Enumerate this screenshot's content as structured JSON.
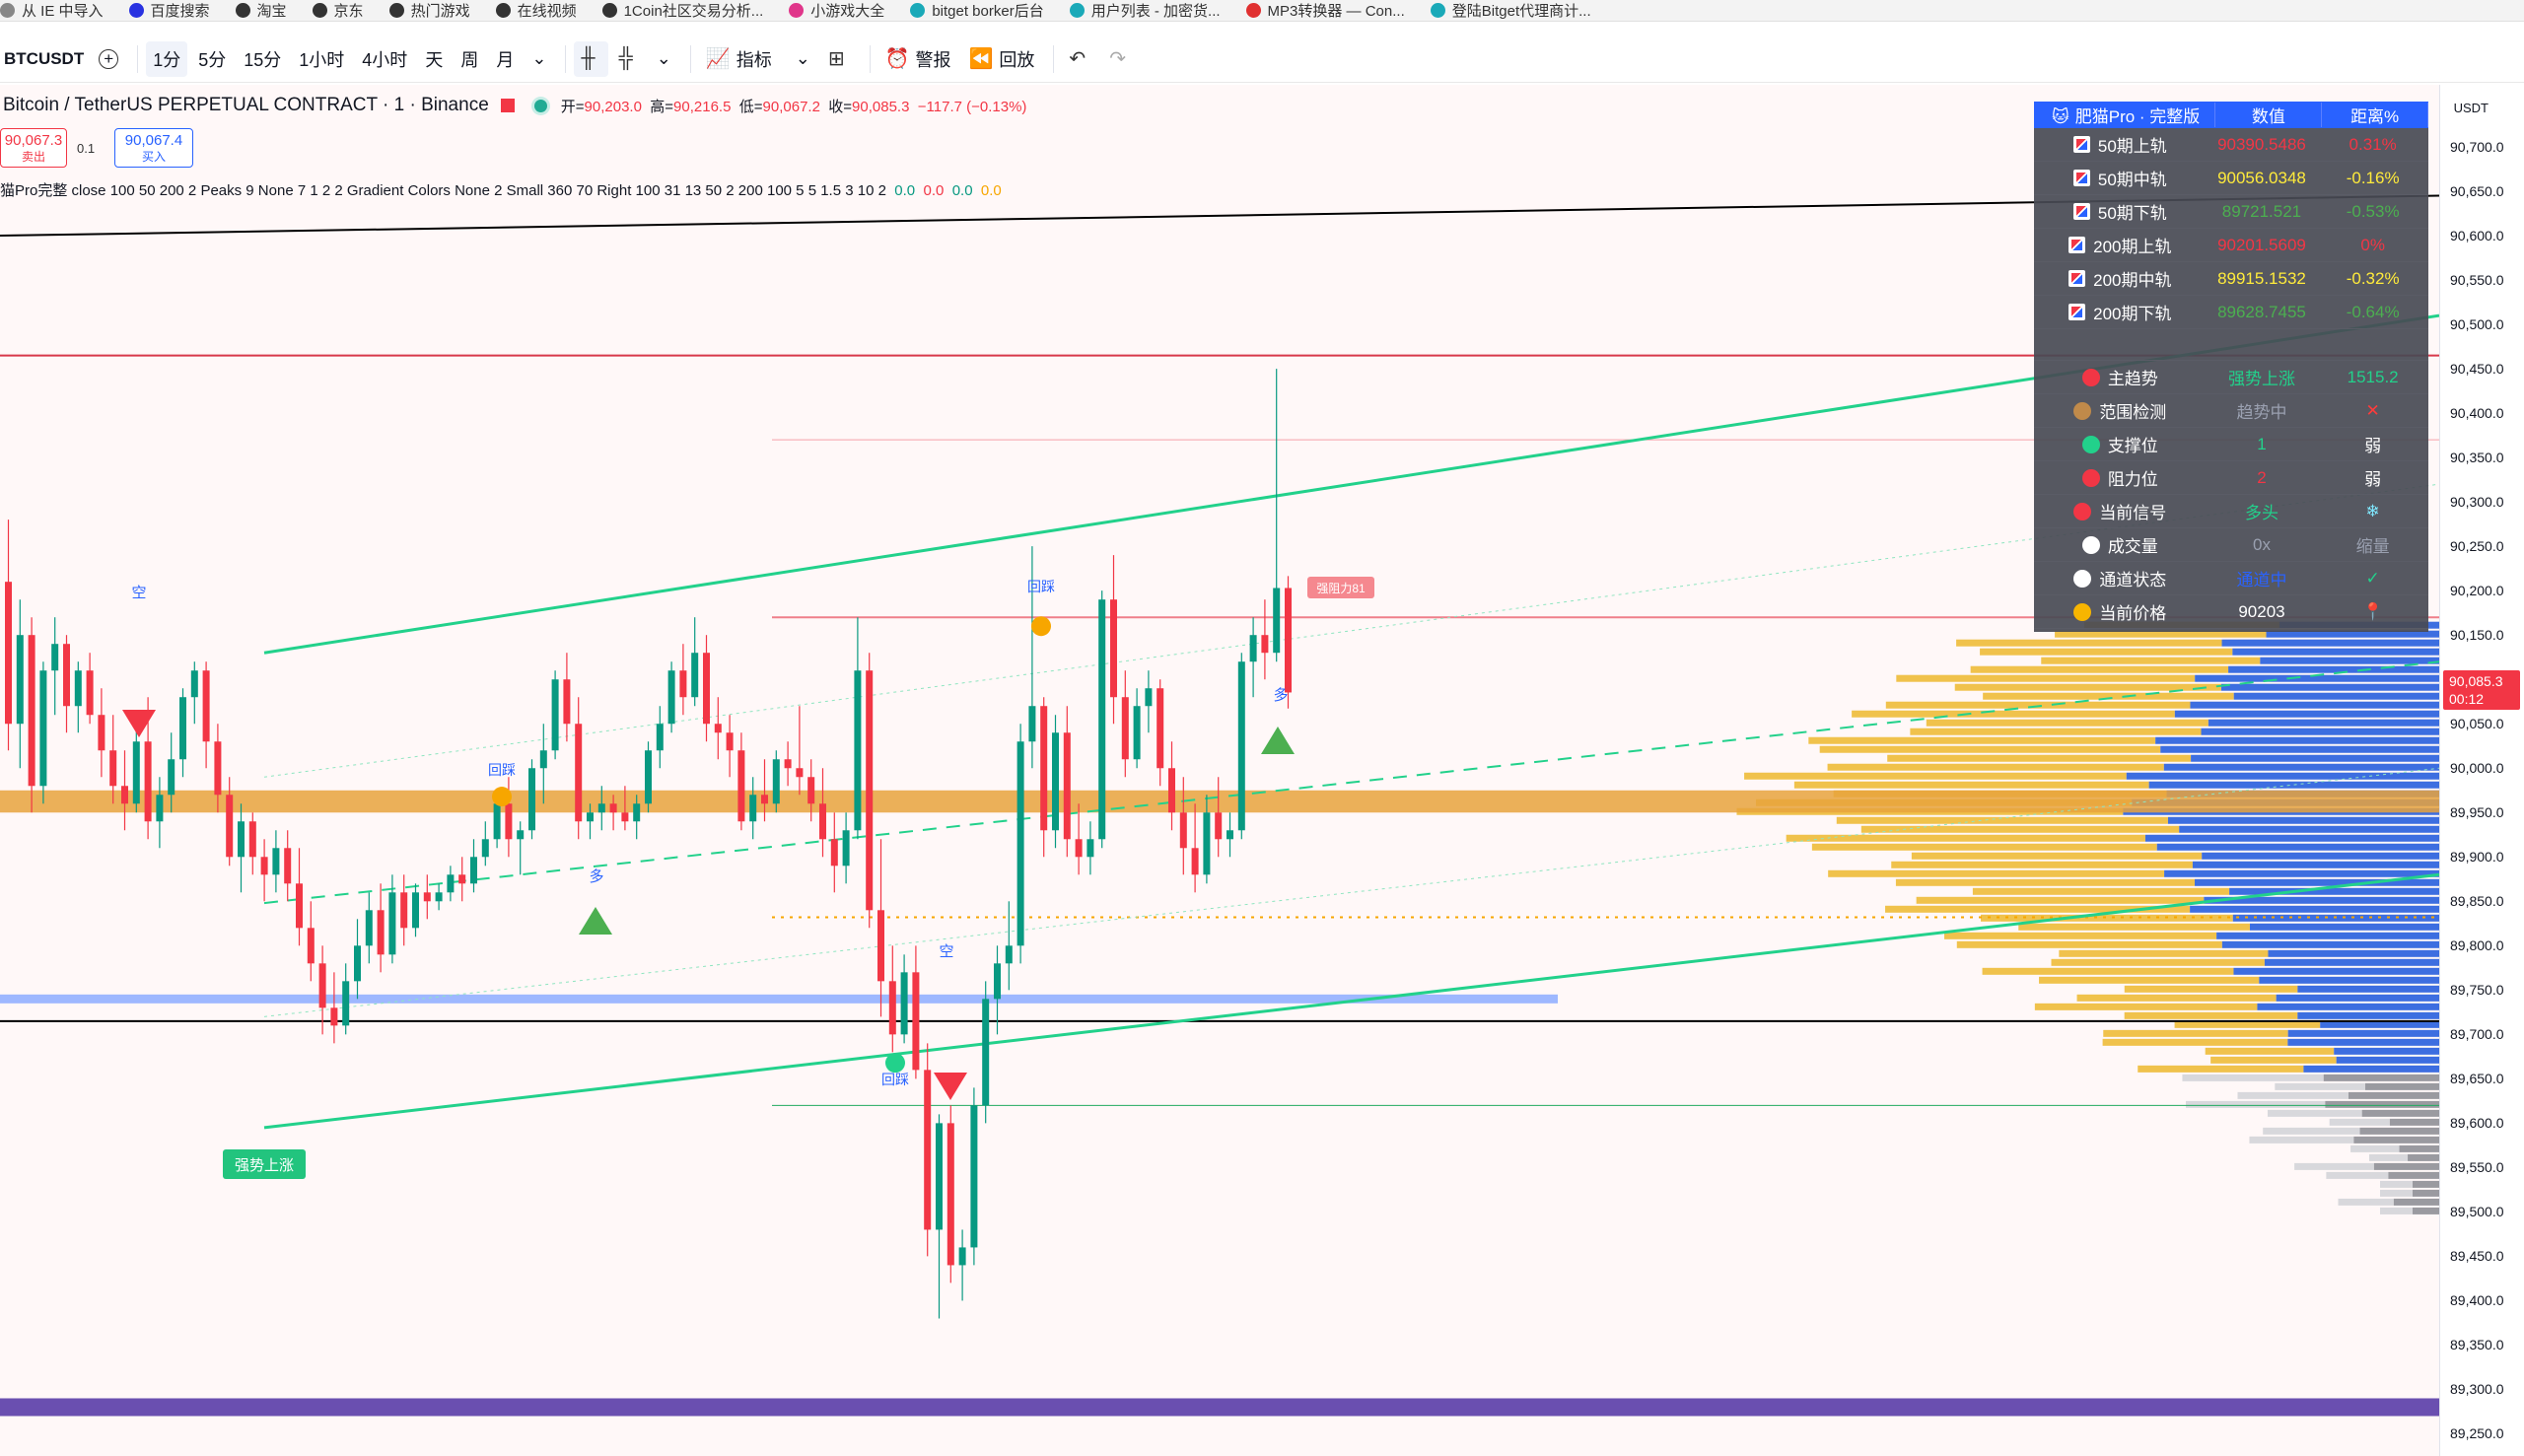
{
  "bookmarks": [
    {
      "label": "从 IE 中导入",
      "icon": "import-icon",
      "color": "#888"
    },
    {
      "label": "百度搜索",
      "icon": "baidu-icon",
      "color": "#2932e1"
    },
    {
      "label": "淘宝",
      "icon": "globe-icon",
      "color": "#333"
    },
    {
      "label": "京东",
      "icon": "globe-icon",
      "color": "#333"
    },
    {
      "label": "热门游戏",
      "icon": "globe-icon",
      "color": "#333"
    },
    {
      "label": "在线视频",
      "icon": "globe-icon",
      "color": "#333"
    },
    {
      "label": "1Coin社区交易分析...",
      "icon": "globe-icon",
      "color": "#333"
    },
    {
      "label": "小游戏大全",
      "icon": "game-icon",
      "color": "#e0368a"
    },
    {
      "label": "bitget borker后台",
      "icon": "bitget-icon",
      "color": "#1aa9b8"
    },
    {
      "label": "用户列表 - 加密货...",
      "icon": "bitget-icon",
      "color": "#1aa9b8"
    },
    {
      "label": "MP3转换器 — Con...",
      "icon": "mp3-icon",
      "color": "#e03030"
    },
    {
      "label": "登陆Bitget代理商计...",
      "icon": "bitget-icon",
      "color": "#1aa9b8"
    }
  ],
  "toolbar": {
    "symbol": "BTCUSDT",
    "intervals": [
      "1分",
      "5分",
      "15分",
      "1小时",
      "4小时",
      "天",
      "周",
      "月"
    ],
    "active_interval": "1分",
    "indicators": "指标",
    "alert": "警报",
    "replay": "回放"
  },
  "legend": {
    "title": "Bitcoin / TetherUS PERPETUAL CONTRACT · 1 · Binance",
    "open_label": "开=",
    "open": "90,203.0",
    "high_label": "高=",
    "high": "90,216.5",
    "low_label": "低=",
    "low": "90,067.2",
    "close_label": "收=",
    "close": "90,085.3",
    "change": "−117.7 (−0.13%)"
  },
  "order_boxes": {
    "sell_price": "90,067.3",
    "sell_label": "卖出",
    "spread": "0.1",
    "buy_price": "90,067.4",
    "buy_label": "买入"
  },
  "indicator_line": {
    "text": "猫Pro完整 close 100 50 200 2 Peaks 9 None 7 1 2 2 Gradient Colors None 2 Small 360 70 Right 100 31 13 50 2 200 100 5 5 1.5 3 10 2",
    "v1": "0.0",
    "v2": "0.0",
    "v3": "0.0",
    "v4": "0.0"
  },
  "price_axis": {
    "currency": "USDT",
    "ticks": [
      "90,700.0",
      "90,650.0",
      "90,600.0",
      "90,550.0",
      "90,500.0",
      "90,450.0",
      "90,400.0",
      "90,350.0",
      "90,300.0",
      "90,250.0",
      "90,200.0",
      "90,150.0",
      "90,100.0",
      "90,050.0",
      "90,000.0",
      "89,950.0",
      "89,900.0",
      "89,850.0",
      "89,800.0",
      "89,750.0",
      "89,700.0",
      "89,650.0",
      "89,600.0",
      "89,550.0",
      "89,500.0",
      "89,450.0",
      "89,400.0",
      "89,350.0",
      "89,300.0",
      "89,250.0"
    ],
    "current_price": "90,085.3",
    "countdown": "00:12"
  },
  "chart_labels": {
    "short1": "空",
    "short2": "空",
    "long1": "多",
    "long2": "多",
    "trace1": "回踩",
    "trace2": "回踩",
    "trace3": "回踩",
    "strong_up": "强势上涨",
    "pressure": "强阻力81"
  },
  "panel": {
    "header": [
      "肥猫Pro · 完整版",
      "数值",
      "距离%"
    ],
    "rows": [
      {
        "name": "50期上轨",
        "value": "90390.5486",
        "dist": "0.31%",
        "color": "#f23645"
      },
      {
        "name": "50期中轨",
        "value": "90056.0348",
        "dist": "-0.16%",
        "color": "#ffeb3b"
      },
      {
        "name": "50期下轨",
        "value": "89721.521",
        "dist": "-0.53%",
        "color": "#4caf50"
      },
      {
        "name": "200期上轨",
        "value": "90201.5609",
        "dist": "0%",
        "color": "#f23645"
      },
      {
        "name": "200期中轨",
        "value": "89915.1532",
        "dist": "-0.32%",
        "color": "#ffeb3b"
      },
      {
        "name": "200期下轨",
        "value": "89628.7455",
        "dist": "-0.64%",
        "color": "#4caf50"
      }
    ],
    "status": [
      {
        "name": "主趋势",
        "value": "强势上涨",
        "extra": "1515.2",
        "vcolor": "#22d18b",
        "ecolor": "#22d18b",
        "icon": "target-icon"
      },
      {
        "name": "范围检测",
        "value": "趋势中",
        "extra": "✕",
        "vcolor": "#9aa0b0",
        "ecolor": "#ff3b3b",
        "icon": "range-icon"
      },
      {
        "name": "支撑位",
        "value": "1",
        "extra": "弱",
        "vcolor": "#22d18b",
        "ecolor": "#ffffff",
        "icon": "support-icon"
      },
      {
        "name": "阻力位",
        "value": "2",
        "extra": "弱",
        "vcolor": "#f23645",
        "ecolor": "#ffffff",
        "icon": "resistance-icon"
      },
      {
        "name": "当前信号",
        "value": "多头",
        "extra": "❄",
        "vcolor": "#22d18b",
        "ecolor": "#7fe7ff",
        "icon": "signal-icon"
      },
      {
        "name": "成交量",
        "value": "0x",
        "extra": "缩量",
        "vcolor": "#9aa0b0",
        "ecolor": "#9aa0b0",
        "icon": "volume-icon"
      },
      {
        "name": "通道状态",
        "value": "通道中",
        "extra": "✓",
        "vcolor": "#2962ff",
        "ecolor": "#22d18b",
        "icon": "channel-icon"
      },
      {
        "name": "当前价格",
        "value": "90203",
        "extra": "📍",
        "vcolor": "#ffffff",
        "ecolor": "#f23645",
        "icon": "price-icon"
      }
    ]
  },
  "colors": {
    "up": "#089981",
    "down": "#f23645",
    "green_line": "#22d18b",
    "orange": "#e8a33d",
    "blue": "#2962ff"
  },
  "chart_data": {
    "type": "candlestick",
    "y_range": [
      89225,
      90770
    ],
    "candles": [
      [
        90210,
        90280,
        90020,
        90050
      ],
      [
        90050,
        90190,
        90000,
        90150
      ],
      [
        90150,
        90170,
        89950,
        89980
      ],
      [
        89980,
        90120,
        89960,
        90110
      ],
      [
        90110,
        90170,
        90060,
        90140
      ],
      [
        90140,
        90150,
        90040,
        90070
      ],
      [
        90070,
        90120,
        90040,
        90110
      ],
      [
        90110,
        90130,
        90050,
        90060
      ],
      [
        90060,
        90090,
        89990,
        90020
      ],
      [
        90020,
        90060,
        89960,
        89980
      ],
      [
        89980,
        90020,
        89930,
        89960
      ],
      [
        89960,
        90050,
        89950,
        90030
      ],
      [
        90030,
        90080,
        89920,
        89940
      ],
      [
        89940,
        89990,
        89910,
        89970
      ],
      [
        89970,
        90040,
        89950,
        90010
      ],
      [
        90010,
        90090,
        89990,
        90080
      ],
      [
        90080,
        90120,
        90050,
        90110
      ],
      [
        90110,
        90120,
        90000,
        90030
      ],
      [
        90030,
        90050,
        89950,
        89970
      ],
      [
        89970,
        89990,
        89890,
        89900
      ],
      [
        89900,
        89960,
        89860,
        89940
      ],
      [
        89940,
        89950,
        89880,
        89900
      ],
      [
        89900,
        89920,
        89850,
        89880
      ],
      [
        89880,
        89930,
        89860,
        89910
      ],
      [
        89910,
        89930,
        89850,
        89870
      ],
      [
        89870,
        89910,
        89800,
        89820
      ],
      [
        89820,
        89850,
        89760,
        89780
      ],
      [
        89780,
        89800,
        89700,
        89730
      ],
      [
        89730,
        89770,
        89690,
        89710
      ],
      [
        89710,
        89780,
        89700,
        89760
      ],
      [
        89760,
        89830,
        89740,
        89800
      ],
      [
        89800,
        89860,
        89780,
        89840
      ],
      [
        89840,
        89870,
        89770,
        89790
      ],
      [
        89790,
        89880,
        89780,
        89860
      ],
      [
        89860,
        89880,
        89800,
        89820
      ],
      [
        89820,
        89870,
        89810,
        89860
      ],
      [
        89860,
        89880,
        89830,
        89850
      ],
      [
        89850,
        89870,
        89840,
        89860
      ],
      [
        89860,
        89890,
        89850,
        89880
      ],
      [
        89880,
        89900,
        89850,
        89870
      ],
      [
        89870,
        89920,
        89860,
        89900
      ],
      [
        89900,
        89940,
        89890,
        89920
      ],
      [
        89920,
        89970,
        89910,
        89960
      ],
      [
        89960,
        89990,
        89900,
        89920
      ],
      [
        89920,
        89940,
        89880,
        89930
      ],
      [
        89930,
        90010,
        89920,
        90000
      ],
      [
        90000,
        90050,
        89960,
        90020
      ],
      [
        90020,
        90110,
        90010,
        90100
      ],
      [
        90100,
        90130,
        90030,
        90050
      ],
      [
        90050,
        90080,
        89920,
        89940
      ],
      [
        89940,
        89960,
        89920,
        89950
      ],
      [
        89950,
        89980,
        89930,
        89960
      ],
      [
        89960,
        89970,
        89930,
        89950
      ],
      [
        89950,
        89980,
        89930,
        89940
      ],
      [
        89940,
        89970,
        89920,
        89960
      ],
      [
        89960,
        90030,
        89950,
        90020
      ],
      [
        90020,
        90070,
        90000,
        90050
      ],
      [
        90050,
        90120,
        90040,
        90110
      ],
      [
        90110,
        90140,
        90060,
        90080
      ],
      [
        90080,
        90170,
        90070,
        90130
      ],
      [
        90130,
        90150,
        90030,
        90050
      ],
      [
        90050,
        90080,
        90010,
        90040
      ],
      [
        90040,
        90060,
        89990,
        90020
      ],
      [
        90020,
        90040,
        89930,
        89940
      ],
      [
        89940,
        89990,
        89920,
        89970
      ],
      [
        89970,
        90010,
        89940,
        89960
      ],
      [
        89960,
        90020,
        89950,
        90010
      ],
      [
        90010,
        90030,
        89980,
        90000
      ],
      [
        90000,
        90070,
        89970,
        89990
      ],
      [
        89990,
        90010,
        89940,
        89960
      ],
      [
        89960,
        90000,
        89900,
        89920
      ],
      [
        89920,
        89950,
        89860,
        89890
      ],
      [
        89890,
        89950,
        89870,
        89930
      ],
      [
        89930,
        90170,
        89920,
        90110
      ],
      [
        90110,
        90130,
        89820,
        89840
      ],
      [
        89840,
        89920,
        89720,
        89760
      ],
      [
        89760,
        89800,
        89680,
        89700
      ],
      [
        89700,
        89790,
        89690,
        89770
      ],
      [
        89770,
        89800,
        89650,
        89660
      ],
      [
        89660,
        89690,
        89450,
        89480
      ],
      [
        89480,
        89610,
        89380,
        89600
      ],
      [
        89600,
        89620,
        89420,
        89440
      ],
      [
        89440,
        89480,
        89400,
        89460
      ],
      [
        89460,
        89640,
        89440,
        89620
      ],
      [
        89620,
        89760,
        89600,
        89740
      ],
      [
        89740,
        89800,
        89700,
        89780
      ],
      [
        89780,
        89850,
        89750,
        89800
      ],
      [
        89800,
        90050,
        89780,
        90030
      ],
      [
        90030,
        90250,
        90000,
        90070
      ],
      [
        90070,
        90080,
        89900,
        89930
      ],
      [
        89930,
        90060,
        89910,
        90040
      ],
      [
        90040,
        90070,
        89900,
        89920
      ],
      [
        89920,
        89960,
        89880,
        89900
      ],
      [
        89900,
        89940,
        89880,
        89920
      ],
      [
        89920,
        90200,
        89910,
        90190
      ],
      [
        90190,
        90240,
        90050,
        90080
      ],
      [
        90080,
        90110,
        89990,
        90010
      ],
      [
        90010,
        90090,
        90000,
        90070
      ],
      [
        90070,
        90110,
        90040,
        90090
      ],
      [
        90090,
        90100,
        89980,
        90000
      ],
      [
        90000,
        90030,
        89930,
        89950
      ],
      [
        89950,
        89990,
        89880,
        89910
      ],
      [
        89910,
        89960,
        89860,
        89880
      ],
      [
        89880,
        89970,
        89870,
        89950
      ],
      [
        89950,
        89990,
        89900,
        89920
      ],
      [
        89920,
        89950,
        89900,
        89930
      ],
      [
        89930,
        90130,
        89920,
        90120
      ],
      [
        90120,
        90170,
        90080,
        90150
      ],
      [
        90150,
        90190,
        90100,
        90130
      ],
      [
        90130,
        90450,
        90120,
        90203
      ],
      [
        90203,
        90216.5,
        90067.2,
        90085.3
      ]
    ]
  }
}
